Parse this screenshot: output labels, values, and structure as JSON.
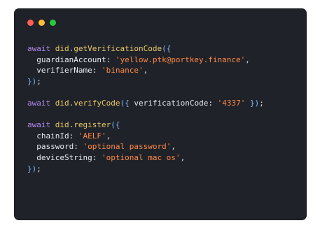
{
  "window": {
    "dots": [
      {
        "name": "close-dot-icon",
        "color": "#ff5f57"
      },
      {
        "name": "minimize-dot-icon",
        "color": "#febc2e"
      },
      {
        "name": "maximize-dot-icon",
        "color": "#28c840"
      }
    ]
  },
  "code": {
    "blocks": [
      {
        "lines": [
          [
            {
              "t": "await ",
              "c": "kw"
            },
            {
              "t": "did",
              "c": "obj"
            },
            {
              "t": ".",
              "c": "plain"
            },
            {
              "t": "getVerificationCode",
              "c": "fn"
            },
            {
              "t": "({",
              "c": "punc"
            }
          ],
          [
            {
              "t": "  guardianAccount: ",
              "c": "key"
            },
            {
              "t": "'yellow.ptk@portkey.finance'",
              "c": "str"
            },
            {
              "t": ",",
              "c": "plain"
            }
          ],
          [
            {
              "t": "  verifierName: ",
              "c": "key"
            },
            {
              "t": "'binance'",
              "c": "str"
            },
            {
              "t": ",",
              "c": "plain"
            }
          ],
          [
            {
              "t": "})",
              "c": "punc"
            },
            {
              "t": ";",
              "c": "plain"
            }
          ]
        ]
      },
      {
        "lines": [
          [
            {
              "t": "await ",
              "c": "kw"
            },
            {
              "t": "did",
              "c": "obj"
            },
            {
              "t": ".",
              "c": "plain"
            },
            {
              "t": "verifyCode",
              "c": "fn"
            },
            {
              "t": "({ ",
              "c": "punc"
            },
            {
              "t": "verificationCode: ",
              "c": "key"
            },
            {
              "t": "'4337'",
              "c": "str"
            },
            {
              "t": " })",
              "c": "punc"
            },
            {
              "t": ";",
              "c": "plain"
            }
          ]
        ]
      },
      {
        "lines": [
          [
            {
              "t": "await ",
              "c": "kw"
            },
            {
              "t": "did",
              "c": "obj"
            },
            {
              "t": ".",
              "c": "plain"
            },
            {
              "t": "register",
              "c": "fn"
            },
            {
              "t": "({",
              "c": "punc"
            }
          ],
          [
            {
              "t": "  chainId: ",
              "c": "key"
            },
            {
              "t": "'AELF'",
              "c": "str"
            },
            {
              "t": ",",
              "c": "plain"
            }
          ],
          [
            {
              "t": "  password: ",
              "c": "key"
            },
            {
              "t": "'optional password'",
              "c": "str"
            },
            {
              "t": ",",
              "c": "plain"
            }
          ],
          [
            {
              "t": "  deviceString: ",
              "c": "key"
            },
            {
              "t": "'optional mac os'",
              "c": "str"
            },
            {
              "t": ",",
              "c": "plain"
            }
          ],
          [
            {
              "t": "})",
              "c": "punc"
            },
            {
              "t": ";",
              "c": "plain"
            }
          ]
        ]
      }
    ]
  }
}
